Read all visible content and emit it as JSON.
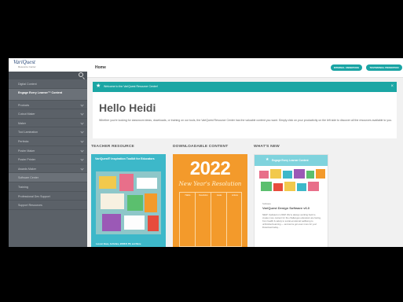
{
  "sidebar": {
    "logo_text": "VariQuest",
    "logo_sub": "Resource Center",
    "items": [
      {
        "label": "Digital Content"
      },
      {
        "label": "Engage Every Learner™ Content"
      },
      {
        "label": "Products"
      },
      {
        "label": "Cutout Maker"
      },
      {
        "label": "Maker"
      },
      {
        "label": "Tool Lamination"
      },
      {
        "label": "Perfecta"
      },
      {
        "label": "Poster Maker"
      },
      {
        "label": "Poster Printer"
      },
      {
        "label": "Awards Maker"
      },
      {
        "label": "Software Center"
      },
      {
        "label": "Training"
      },
      {
        "label": "Professional Dev Support"
      },
      {
        "label": "Support Resources"
      }
    ]
  },
  "topbar": {
    "title": "Home",
    "btn_a": "INTERNAL UNDERTAKE",
    "btn_b": "TESTIMONIAL PROMOTION"
  },
  "welcome": {
    "text": "Welcome to the VariQuest Resource Center!"
  },
  "hello": {
    "title": "Hello Heidi",
    "description": "Whether you're looking for classroom ideas, downloads, or training on our tools, the VariQuest Resource Center has the valuable content you want. Simply click on your productivity on the left side to discover all the resources available to you."
  },
  "sections": {
    "teacher": "TEACHER RESOURCE",
    "downloadable": "DOWNLOADABLE CONTENT",
    "whats_new": "WHAT'S NEW"
  },
  "card_teacher": {
    "heading": "VariQuest® Inspiration Toolkit for Educators",
    "footer": "Lesson Ideas, Activities, BONUS PD, and More"
  },
  "card_download": {
    "year": "2022",
    "script": "New Year's Resolution",
    "cols": [
      "Habits",
      "Resolution",
      "Goals",
      "Actions"
    ]
  },
  "card_new": {
    "banner": "Engage Every Learner Content",
    "tag": "Software",
    "title": "VariQuest Design Software v6.0",
    "text": "NEW: Updated on 2022! We're always working hard to create more content for the challenges educators are facing, from health & safety to social-emotional wellbeing to unfinished learning — and we've got even more for you! Download today..."
  }
}
